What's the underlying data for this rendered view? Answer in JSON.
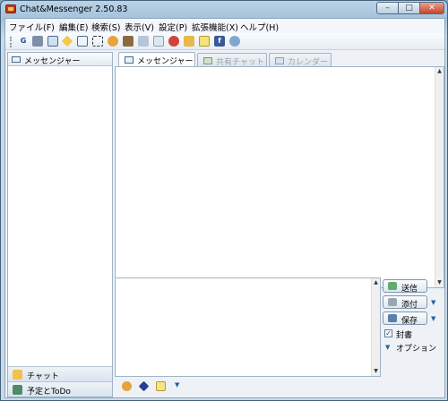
{
  "window": {
    "title": "Chat&Messenger 2.50.83",
    "minimize": "–",
    "maximize": "□",
    "close": "✕"
  },
  "menubar": {
    "items": [
      "ファイル(F)",
      "編集(E)",
      "検索(S)",
      "表示(V)",
      "設定(P)",
      "拡張機能(X)",
      "ヘルプ(H)"
    ]
  },
  "toolbar": {
    "icons": [
      "g-icon",
      "contacts-icon",
      "calendar-icon",
      "diamond-icon",
      "window-icon",
      "select-icon",
      "star-icon",
      "tool-icon",
      "user-icon",
      "sort-icon",
      "color-icon",
      "folder-icon",
      "note-icon",
      "facebook-icon",
      "network-icon"
    ],
    "glyph_g": "G",
    "glyph_f": "f"
  },
  "left_panel": {
    "header": "メッセンジャー",
    "bottom_items": [
      {
        "label": "チャット",
        "icon": "chat-icon"
      },
      {
        "label": "予定とToDo",
        "icon": "todo-icon"
      }
    ]
  },
  "tabs": [
    {
      "label": "メッセンジャー",
      "icon": "messenger-icon",
      "active": true
    },
    {
      "label": "共有チャット",
      "icon": "shared-chat-icon",
      "active": false
    },
    {
      "label": "カレンダー",
      "icon": "calendar-icon",
      "active": false
    }
  ],
  "actions": {
    "send": "送信",
    "attach": "添付",
    "save": "保存",
    "sealed": "封書",
    "sealed_checked": true,
    "options": "オプション",
    "dropdown": "▼",
    "check": "✓"
  },
  "compose_tools": {
    "icons": [
      "emoji-icon",
      "stamp-icon",
      "memo-icon"
    ],
    "dropdown": "▼"
  },
  "colors": {
    "accent": "#2a5ea0",
    "titlebar": "#b9d3e6"
  }
}
